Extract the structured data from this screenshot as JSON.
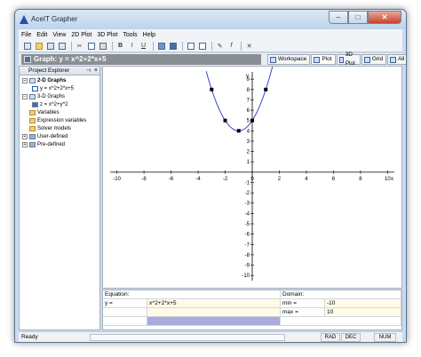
{
  "window": {
    "title": "AceIT Grapher",
    "min_glyph": "–",
    "max_glyph": "□",
    "close_glyph": "✕"
  },
  "menu": [
    "File",
    "Edit",
    "View",
    "2D Plot",
    "3D Plot",
    "Tools",
    "Help"
  ],
  "graph_bar": {
    "title": "Graph: y = x^2+2*x+5"
  },
  "tabs": [
    {
      "label": "Workspace",
      "icon": "workspace-icon"
    },
    {
      "label": "Plot",
      "icon": "plot-icon"
    },
    {
      "label": "3D Plot",
      "icon": "3d-plot-icon"
    },
    {
      "label": "Grid",
      "icon": "grid-icon"
    },
    {
      "label": "All",
      "icon": "all-icon"
    }
  ],
  "explorer": {
    "title": "Project Explorer",
    "pin": "⊣",
    "close": "×",
    "items": [
      {
        "label": "2-D Graphs",
        "bold": true
      },
      {
        "label": "y = x^2+2*x+5",
        "bold": false
      },
      {
        "label": "3-D Graphs",
        "bold": false
      },
      {
        "label": "z = x^2+y^2",
        "bold": false
      },
      {
        "label": "Variables",
        "bold": false
      },
      {
        "label": "Expression variables",
        "bold": false
      },
      {
        "label": "Solver models",
        "bold": false
      },
      {
        "label": "User-defined",
        "bold": false
      },
      {
        "label": "Pre-defined",
        "bold": false
      }
    ]
  },
  "chart_data": {
    "type": "line",
    "xlim": [
      -10.5,
      10.5
    ],
    "ylim": [
      -10.5,
      9.7
    ],
    "x_ticks": [
      -10,
      -8,
      -6,
      -4,
      -2,
      0,
      2,
      4,
      6,
      8,
      10
    ],
    "x_tick_labels": [
      "-10",
      "-8",
      "-6",
      "-4",
      "-2",
      "0",
      "2",
      "4",
      "6",
      "8",
      "10"
    ],
    "y_ticks": [
      9,
      8,
      7,
      6,
      5,
      4,
      3,
      2,
      1,
      -1,
      -2,
      -3,
      -4,
      -5,
      -6,
      -7,
      -8,
      -9,
      -10
    ],
    "y_tick_labels": [
      "9",
      "8",
      "7",
      "6",
      "5",
      "4",
      "3",
      "2",
      "1",
      "-1",
      "-2",
      "-3",
      "-4",
      "-5",
      "-6",
      "-7",
      "-8",
      "-9",
      "-10"
    ],
    "xlabel": "x",
    "ylabel": "y",
    "series": [
      {
        "expression": "y = x^2+2*x+5",
        "x_range": [
          -3.4,
          1.7
        ],
        "color": "#2233cc"
      }
    ],
    "markers": [
      {
        "x": -3,
        "y": 8
      },
      {
        "x": -2,
        "y": 5
      },
      {
        "x": -1,
        "y": 4
      },
      {
        "x": 0,
        "y": 5
      },
      {
        "x": 1,
        "y": 8
      }
    ],
    "grid": false
  },
  "equation_panel": {
    "equation_header": "Equation:",
    "domain_header": "Domain:",
    "row_label": "y =",
    "expression": "x^2+2*x+5",
    "min_label": "min =",
    "min_value": "-10",
    "max_label": "max =",
    "max_value": "10"
  },
  "status": {
    "text": "Ready",
    "cells": [
      "RAD",
      "DEC",
      "NUM"
    ]
  },
  "colors": {
    "accent": "#2233cc",
    "title_bar_bg": "#8a8f95",
    "highlight": "#aaaadd"
  }
}
